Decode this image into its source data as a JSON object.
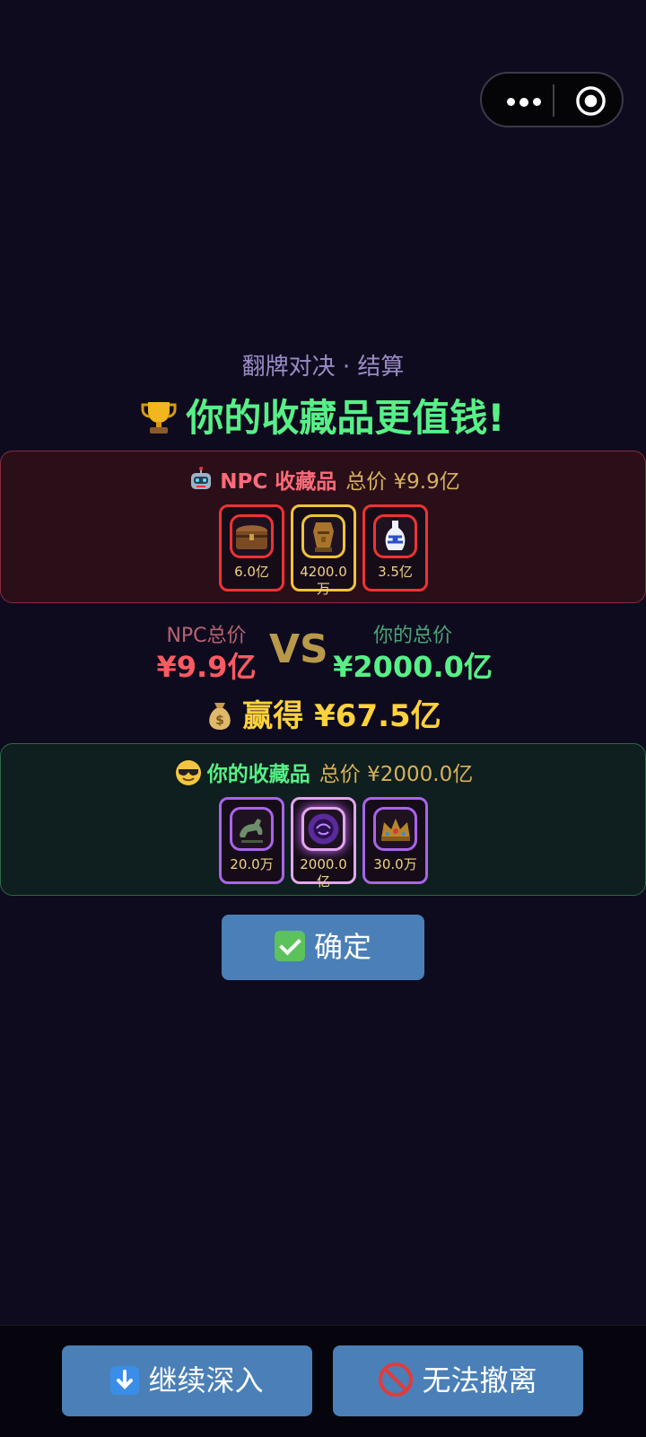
{
  "header": {
    "menu_icon": "more-dots-icon",
    "close_icon": "target-circle-icon"
  },
  "result": {
    "subtitle": "翻牌对决 · 结算",
    "headline": "你的收藏品更值钱!",
    "headline_icon": "trophy-icon"
  },
  "npc": {
    "icon": "robot-icon",
    "title": "NPC 收藏品",
    "total_label": "总价 ¥9.9亿",
    "items": [
      {
        "icon": "treasure-chest-icon",
        "price": "6.0亿",
        "rarity": "red"
      },
      {
        "icon": "golden-statue-icon",
        "price": "4200.0万",
        "rarity": "gold"
      },
      {
        "icon": "porcelain-vase-icon",
        "price": "3.5亿",
        "rarity": "red"
      }
    ]
  },
  "compare": {
    "npc_label": "NPC总价",
    "npc_value": "¥9.9亿",
    "vs": "VS",
    "player_label": "你的总价",
    "player_value": "¥2000.0亿",
    "win_icon": "money-bag-icon",
    "win_text": "赢得 ¥67.5亿"
  },
  "player": {
    "icon": "sunglasses-face-icon",
    "title": "你的收藏品",
    "total_label": "总价 ¥2000.0亿",
    "items": [
      {
        "icon": "bronze-horse-icon",
        "price": "20.0万",
        "rarity": "purple"
      },
      {
        "icon": "purple-orb-icon",
        "price": "2000.0亿",
        "rarity": "pink"
      },
      {
        "icon": "jeweled-crown-icon",
        "price": "30.0万",
        "rarity": "purple"
      }
    ]
  },
  "confirm_label": "确定",
  "bottom": {
    "left_label": "继续深入",
    "right_label": "无法撤离"
  },
  "colors": {
    "background": "#0e0b1f",
    "win_green": "#57f087",
    "npc_red": "#ff5a62",
    "gold": "#ffd23e",
    "button_blue": "#4a7fb7"
  }
}
